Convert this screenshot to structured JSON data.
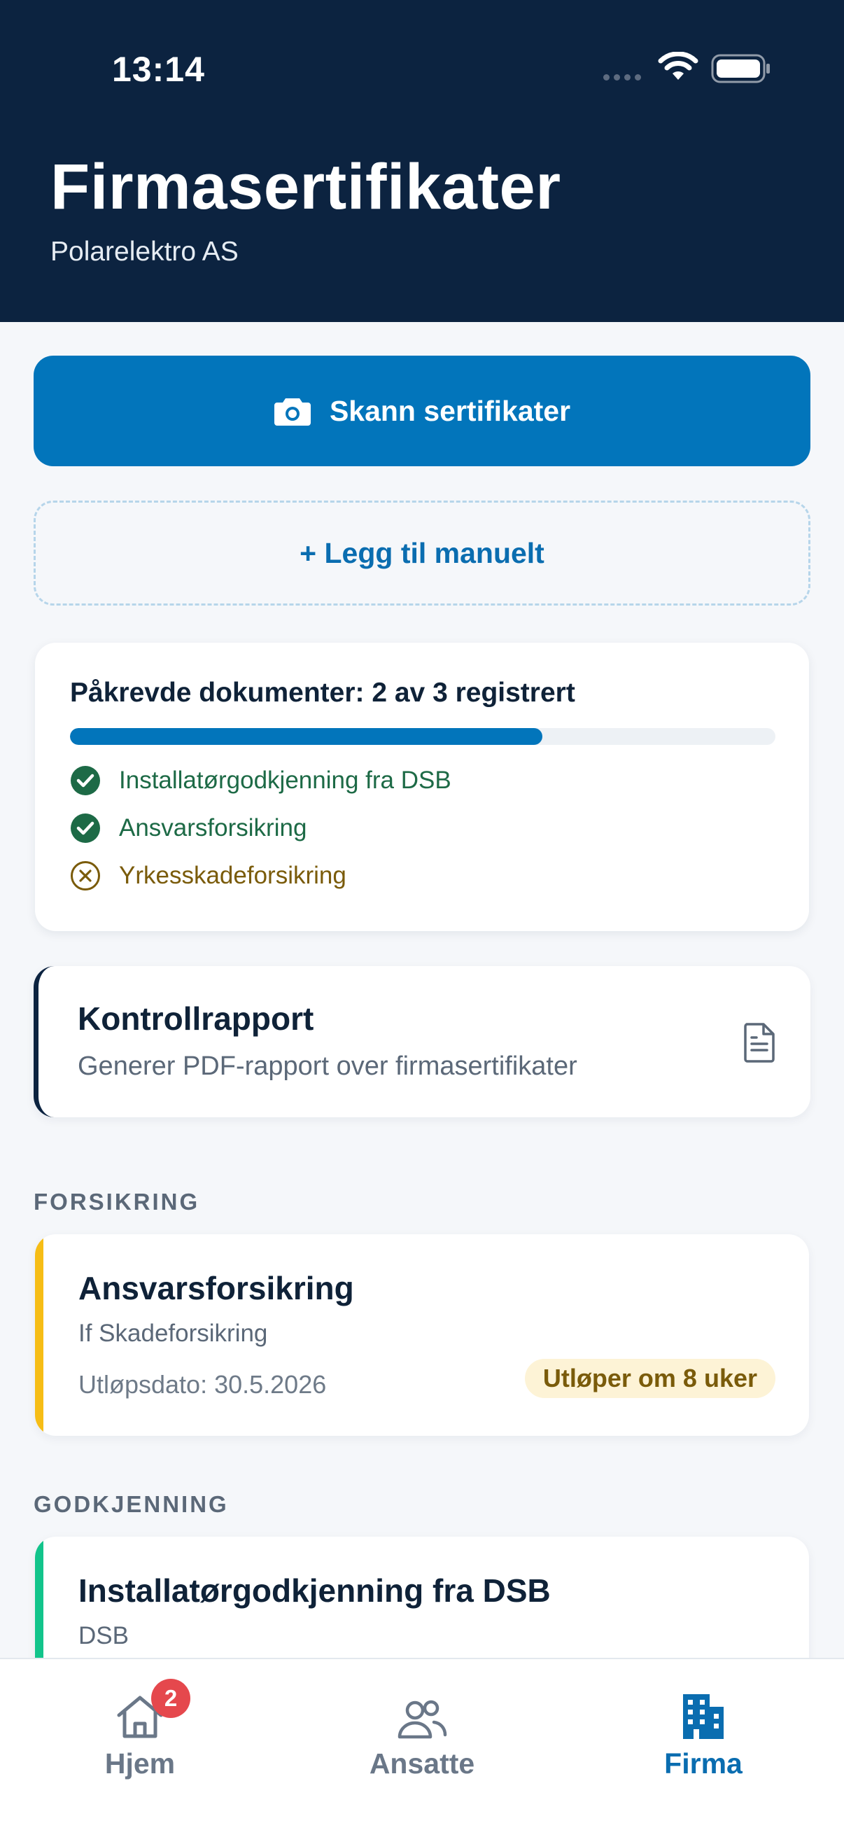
{
  "status_bar": {
    "time": "13:14"
  },
  "header": {
    "title": "Firmasertifikater",
    "subtitle": "Polarelektro AS"
  },
  "actions": {
    "scan_label": "Skann sertifikater",
    "manual_label": "+ Legg til manuelt"
  },
  "required_docs": {
    "title": "Påkrevde dokumenter: 2 av 3 registrert",
    "progress": 0.67,
    "items": [
      {
        "label": "Installatørgodkjenning fra DSB",
        "status": "ok"
      },
      {
        "label": "Ansvarsforsikring",
        "status": "ok"
      },
      {
        "label": "Yrkesskadeforsikring",
        "status": "missing"
      }
    ]
  },
  "report": {
    "title": "Kontrollrapport",
    "subtitle": "Generer PDF-rapport over firmasertifikater"
  },
  "sections": [
    {
      "label": "FORSIKRING",
      "cards": [
        {
          "title": "Ansvarsforsikring",
          "issuer": "If Skadeforsikring",
          "expiry": "Utløpsdato: 30.5.2026",
          "badge": "Utløper om 8 uker",
          "accent": "#f6bd16"
        }
      ]
    },
    {
      "label": "GODKJENNING",
      "cards": [
        {
          "title": "Installatørgodkjenning fra DSB",
          "issuer": "DSB",
          "accent": "#12c48b"
        }
      ]
    }
  ],
  "tabbar": {
    "items": [
      {
        "label": "Hjem",
        "icon": "home-icon",
        "badge": "2",
        "active": false
      },
      {
        "label": "Ansatte",
        "icon": "users-icon",
        "active": false
      },
      {
        "label": "Firma",
        "icon": "building-icon",
        "active": true
      }
    ]
  },
  "colors": {
    "header_bg": "#0c2340",
    "primary": "#0275bb",
    "success": "#1d6a46",
    "warning": "#7a5b0a",
    "tab_inactive": "#6a7788"
  }
}
